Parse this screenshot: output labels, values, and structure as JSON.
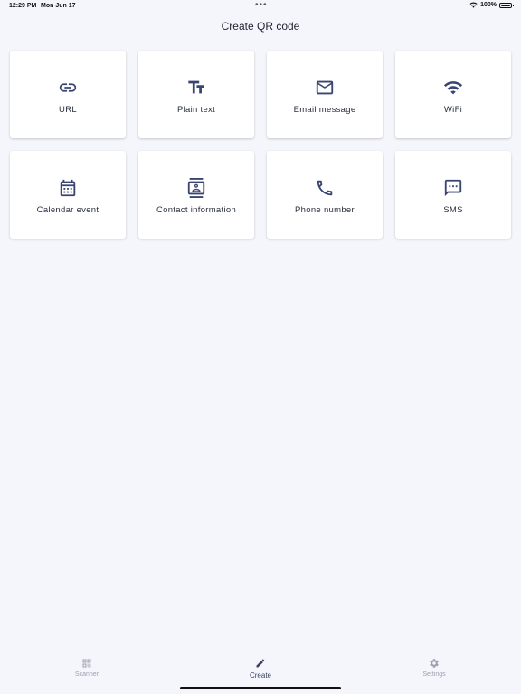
{
  "status_bar": {
    "time": "12:29 PM",
    "date": "Mon Jun 17",
    "dots": "•••",
    "battery_text": "100%",
    "battery_level": 1.0,
    "icons": [
      "wifi-icon",
      "battery-icon"
    ]
  },
  "page": {
    "title": "Create QR code"
  },
  "options": [
    {
      "label": "URL",
      "icon": "link-icon"
    },
    {
      "label": "Plain text",
      "icon": "text-icon"
    },
    {
      "label": "Email message",
      "icon": "envelope-icon"
    },
    {
      "label": "WiFi",
      "icon": "wifi-icon"
    },
    {
      "label": "Calendar event",
      "icon": "calendar-icon"
    },
    {
      "label": "Contact information",
      "icon": "contact-card-icon"
    },
    {
      "label": "Phone number",
      "icon": "phone-icon"
    },
    {
      "label": "SMS",
      "icon": "message-icon"
    }
  ],
  "bottom_nav": {
    "items": [
      {
        "label": "Scanner",
        "icon": "qr-code-icon",
        "active": false
      },
      {
        "label": "Create",
        "icon": "pencil-icon",
        "active": true
      },
      {
        "label": "Settings",
        "icon": "gear-icon",
        "active": false
      }
    ]
  },
  "colors": {
    "background": "#f5f6fc",
    "card": "#ffffff",
    "icon": "#3a4470",
    "nav_inactive": "#9aa0ad",
    "nav_active": "#3a4060"
  }
}
